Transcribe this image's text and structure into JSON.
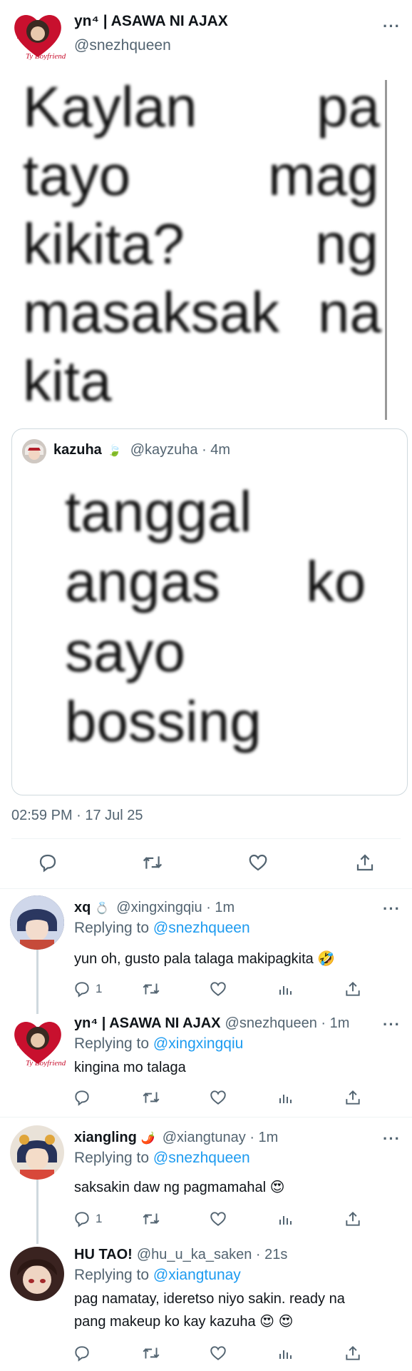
{
  "main_tweet": {
    "display_name": "yn⁴ | ASAWA NI AJAX",
    "handle": "@snezhqueen",
    "avatar_text": "Ty Boyfriend",
    "more": "···",
    "text_lines": [
      {
        "words": [
          "Kaylan",
          "pa"
        ]
      },
      {
        "words": [
          "tayo",
          "mag"
        ]
      },
      {
        "words": [
          "kikita?",
          "ng"
        ]
      },
      {
        "words": [
          "masaksak",
          "na"
        ]
      },
      {
        "words": [
          "kita"
        ]
      }
    ],
    "timestamp": "02:59 PM · 17 Jul 25"
  },
  "quoted_tweet": {
    "display_name": "kazuha",
    "emoji": "🍃",
    "handle_time": "@kayzuha · 4m",
    "text_lines": [
      {
        "words": [
          "tanggal"
        ]
      },
      {
        "words": [
          "angas",
          "ko"
        ]
      },
      {
        "words": [
          "sayo"
        ]
      },
      {
        "words": [
          "bossing"
        ]
      }
    ]
  },
  "replies": [
    {
      "display_name": "xq",
      "emoji": "💍",
      "handle_time": "@xingxingqiu · 1m",
      "replying_prefix": "Replying to",
      "replying_to": "@snezhqueen",
      "text": "yun oh, gusto pala talaga makipagkita 🤣",
      "reply_count": "1"
    },
    {
      "display_name": "yn⁴ | ASAWA NI AJAX",
      "emoji": "",
      "handle_time": "@snezhqueen · 1m",
      "replying_prefix": "Replying to",
      "replying_to": "@xingxingqiu",
      "text": "kingina mo talaga",
      "reply_count": ""
    },
    {
      "display_name": "xiangling",
      "emoji": "🌶️",
      "handle_time": "@xiangtunay · 1m",
      "replying_prefix": "Replying to",
      "replying_to": "@snezhqueen",
      "text": "saksakin daw ng pagmamahal 😍",
      "reply_count": "1"
    },
    {
      "display_name": "HU TAO!",
      "emoji": "",
      "handle_time": "@hu_u_ka_saken · 21s",
      "replying_prefix": "Replying to",
      "replying_to": "@xiangtunay",
      "text_line1": "pag namatay, ideretso niyo sakin. ready na",
      "text_line2": "pang makeup ko kay kazuha 😍 😍",
      "reply_count": ""
    }
  ],
  "colors": {
    "link": "#1d9bf0",
    "secondary": "#536471",
    "border": "#cfd9de",
    "avatar_heart": "#c8102e"
  },
  "icons": [
    "reply-icon",
    "retweet-icon",
    "like-icon",
    "views-icon",
    "share-icon",
    "more-icon"
  ]
}
